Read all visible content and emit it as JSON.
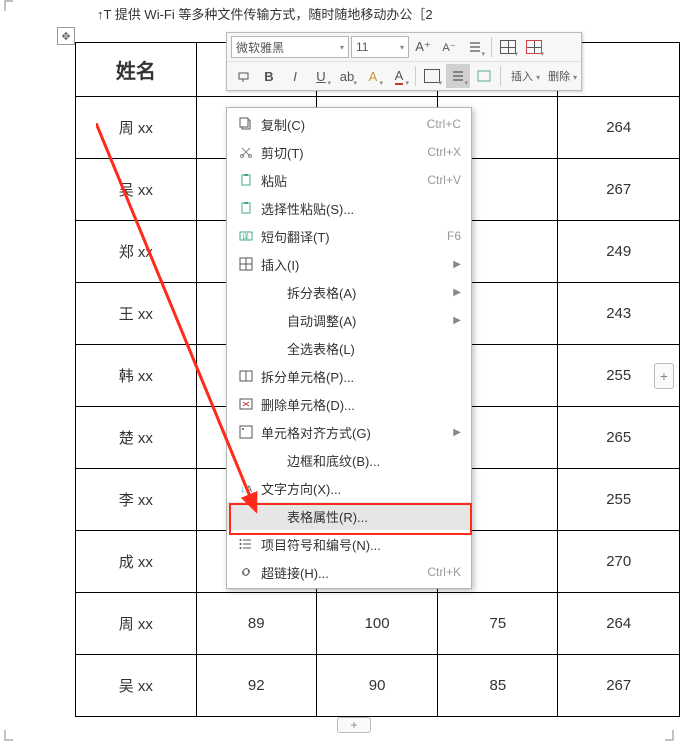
{
  "headerText": "↑T 提供 Wi-Fi 等多种文件传输方式，随时随地移动办公［2",
  "table": {
    "header": "姓名",
    "rows": [
      {
        "name": "周 xx",
        "v1": "",
        "v2": "",
        "v3": "",
        "total": "264"
      },
      {
        "name": "吴 xx",
        "v1": "",
        "v2": "",
        "v3": "",
        "total": "267"
      },
      {
        "name": "郑 xx",
        "v1": "",
        "v2": "",
        "v3": "",
        "total": "249"
      },
      {
        "name": "王 xx",
        "v1": "",
        "v2": "",
        "v3": "",
        "total": "243"
      },
      {
        "name": "韩 xx",
        "v1": "",
        "v2": "",
        "v3": "",
        "total": "255"
      },
      {
        "name": "楚 xx",
        "v1": "",
        "v2": "",
        "v3": "",
        "total": "265"
      },
      {
        "name": "李 xx",
        "v1": "",
        "v2": "",
        "v3": "",
        "total": "255"
      },
      {
        "name": "成 xx",
        "v1": "",
        "v2": "",
        "v3": "",
        "total": "270"
      },
      {
        "name": "周 xx",
        "v1": "89",
        "v2": "100",
        "v3": "75",
        "total": "264"
      },
      {
        "name": "吴 xx",
        "v1": "92",
        "v2": "90",
        "v3": "85",
        "total": "267"
      }
    ]
  },
  "miniToolbar": {
    "fontName": "微软雅黑",
    "fontSize": "11",
    "insertLabel": "插入",
    "deleteLabel": "删除"
  },
  "contextMenu": {
    "items": [
      {
        "icon": "copy",
        "label": "复制(C)",
        "shortcut": "Ctrl+C"
      },
      {
        "icon": "cut",
        "label": "剪切(T)",
        "shortcut": "Ctrl+X"
      },
      {
        "icon": "paste",
        "label": "粘贴",
        "shortcut": "Ctrl+V"
      },
      {
        "icon": "paste-special",
        "label": "选择性粘贴(S)...",
        "shortcut": ""
      },
      {
        "icon": "translate",
        "label": "短句翻译(T)",
        "shortcut": "F6"
      },
      {
        "icon": "insert",
        "label": "插入(I)",
        "shortcut": "",
        "submenu": true
      },
      {
        "icon": "",
        "label": "拆分表格(A)",
        "shortcut": "",
        "submenu": true,
        "indent": true
      },
      {
        "icon": "",
        "label": "自动调整(A)",
        "shortcut": "",
        "submenu": true,
        "indent": true
      },
      {
        "icon": "",
        "label": "全选表格(L)",
        "shortcut": "",
        "indent": true
      },
      {
        "icon": "split",
        "label": "拆分单元格(P)...",
        "shortcut": ""
      },
      {
        "icon": "delete",
        "label": "删除单元格(D)...",
        "shortcut": ""
      },
      {
        "icon": "align",
        "label": "单元格对齐方式(G)",
        "shortcut": "",
        "submenu": true
      },
      {
        "icon": "",
        "label": "边框和底纹(B)...",
        "shortcut": "",
        "indent": true
      },
      {
        "icon": "text-dir",
        "label": "文字方向(X)...",
        "shortcut": ""
      },
      {
        "icon": "",
        "label": "表格属性(R)...",
        "shortcut": "",
        "hover": true,
        "indent": true
      },
      {
        "icon": "list",
        "label": "项目符号和编号(N)...",
        "shortcut": ""
      },
      {
        "icon": "link",
        "label": "超链接(H)...",
        "shortcut": "Ctrl+K"
      }
    ]
  }
}
